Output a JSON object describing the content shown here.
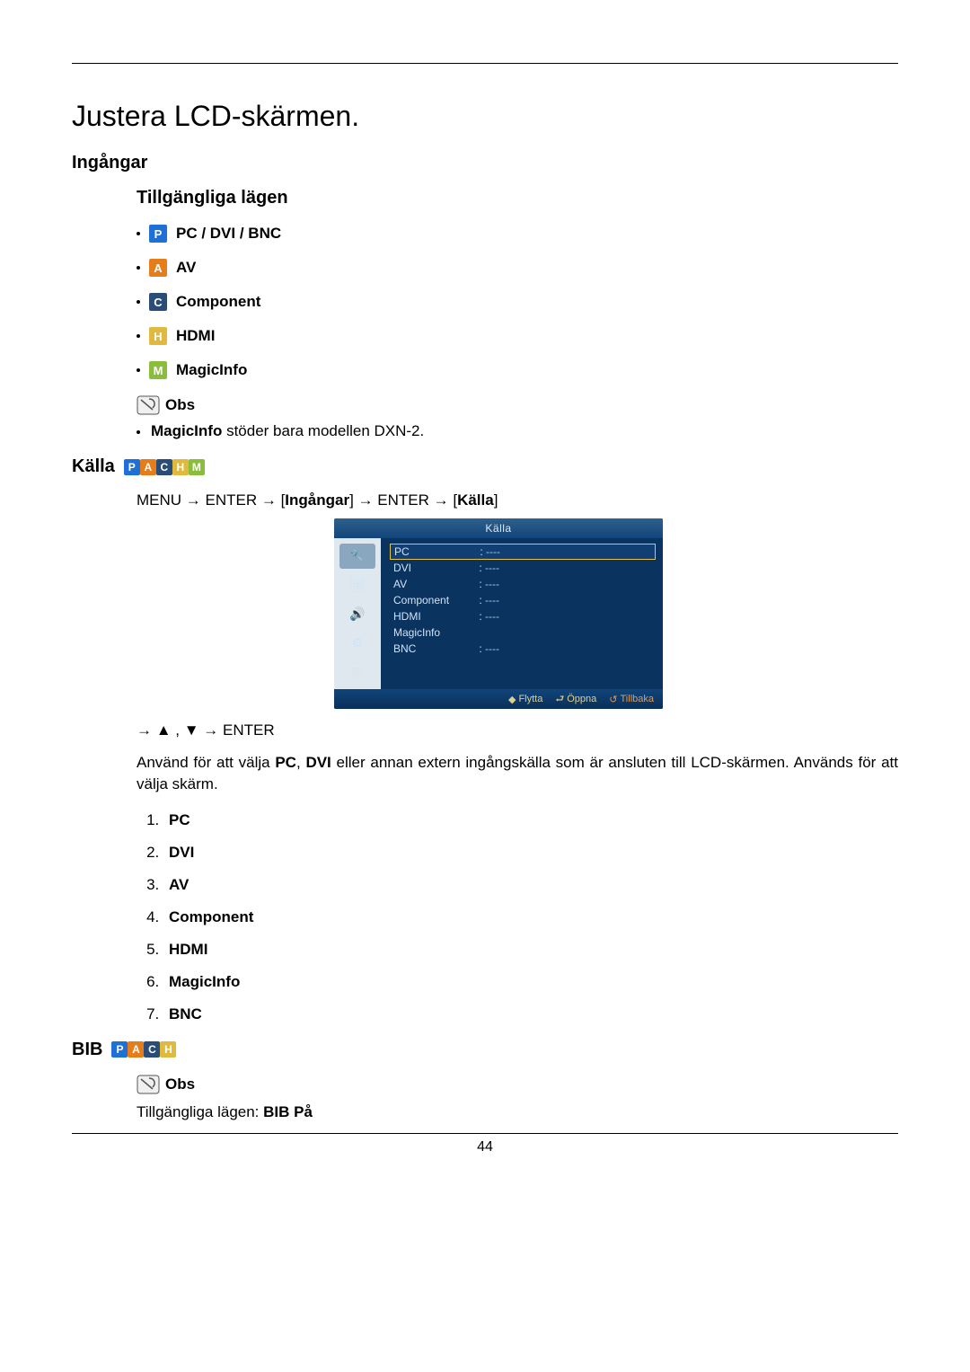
{
  "title": "Justera LCD-skärmen.",
  "section_inputs": "Ingångar",
  "subheading_modes": "Tillgängliga lägen",
  "modes": [
    {
      "badge": "P",
      "color": "#1e6fd6",
      "label": "PC / DVI / BNC"
    },
    {
      "badge": "A",
      "color": "#e57d1a",
      "label": "AV"
    },
    {
      "badge": "C",
      "color": "#2a4d78",
      "label": "Component"
    },
    {
      "badge": "H",
      "color": "#e0ba3e",
      "label": "HDMI"
    },
    {
      "badge": "M",
      "color": "#8bbd3d",
      "label": "MagicInfo"
    }
  ],
  "note_label": "Obs",
  "note_body_bold": "MagicInfo",
  "note_body_rest": " stöder bara modellen DXN-2.",
  "section_source": "Källa",
  "source_strip": [
    {
      "l": "P",
      "c": "#1e6fd6"
    },
    {
      "l": "A",
      "c": "#e57d1a"
    },
    {
      "l": "C",
      "c": "#2a4d78"
    },
    {
      "l": "H",
      "c": "#e0ba3e"
    },
    {
      "l": "M",
      "c": "#8bbd3d"
    }
  ],
  "menu_path": {
    "p1": "MENU → ENTER → ",
    "b1": "Ingångar",
    "p2": " → ENTER → ",
    "b2": "Källa"
  },
  "osd": {
    "header": "Källa",
    "rows": [
      {
        "label": "PC",
        "val": "----",
        "sel": true,
        "colon": ":"
      },
      {
        "label": "DVI",
        "val": "----",
        "colon": ":"
      },
      {
        "label": "AV",
        "val": "----",
        "colon": ":"
      },
      {
        "label": "Component",
        "val": "----",
        "colon": ":"
      },
      {
        "label": "HDMI",
        "val": "----",
        "colon": ":"
      },
      {
        "label": "MagicInfo",
        "val": ""
      },
      {
        "label": "BNC",
        "val": "----",
        "colon": ":"
      }
    ],
    "footer": {
      "move": "Flytta",
      "open": "Öppna",
      "back": "Tillbaka"
    }
  },
  "nav_path": "→ ▲ , ▼ → ENTER",
  "para_pre": "Använd för att välja ",
  "para_b1": "PC",
  "para_mid1": ", ",
  "para_b2": "DVI",
  "para_post": " eller annan extern ingångskälla som är ansluten till LCD-skärmen. Används för att välja skärm.",
  "numlist": [
    "PC",
    "DVI",
    "AV",
    "Component",
    "HDMI",
    "MagicInfo",
    "BNC"
  ],
  "section_bib": "BIB",
  "bib_strip": [
    {
      "l": "P",
      "c": "#1e6fd6"
    },
    {
      "l": "A",
      "c": "#e57d1a"
    },
    {
      "l": "C",
      "c": "#2a4d78"
    },
    {
      "l": "H",
      "c": "#e0ba3e"
    }
  ],
  "bib_note_label": "Obs",
  "bib_note_pre": "Tillgängliga lägen: ",
  "bib_note_bold": "BIB På",
  "page_number": "44"
}
